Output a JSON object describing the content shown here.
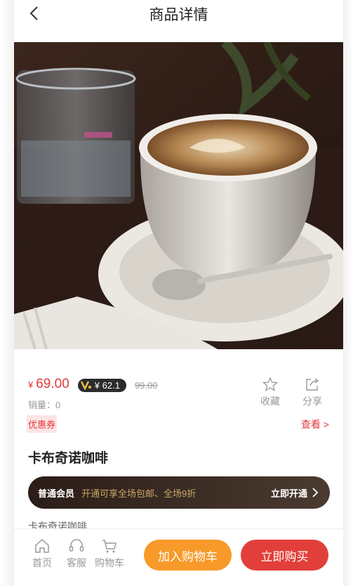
{
  "header": {
    "title": "商品详情",
    "back_icon": "chevron-left-icon"
  },
  "product": {
    "image_alt": "卡布奇诺咖啡 product photo",
    "currency_symbol": "¥",
    "price": "69.00",
    "vip_price": "¥ 62.1",
    "original_price": "99.00",
    "sales_label": "销量：0",
    "name": "卡布奇诺咖啡",
    "description": "卡布奇诺咖啡"
  },
  "actions": {
    "favorite_label": "收藏",
    "share_label": "分享"
  },
  "coupon": {
    "tag": "优惠券",
    "view_label": "查看 >"
  },
  "member": {
    "level": "普通会员",
    "desc": "开通可享全场包邮、全场9折",
    "open_label": "立即开通"
  },
  "bottom_nav": {
    "home": "首页",
    "service": "客服",
    "cart": "购物车",
    "add_to_cart": "加入购物车",
    "buy_now": "立即购买"
  },
  "colors": {
    "accent_red": "#e0393a",
    "cart_orange": "#f79a29",
    "buy_red": "#e23f3a",
    "member_gold": "#cba868"
  }
}
